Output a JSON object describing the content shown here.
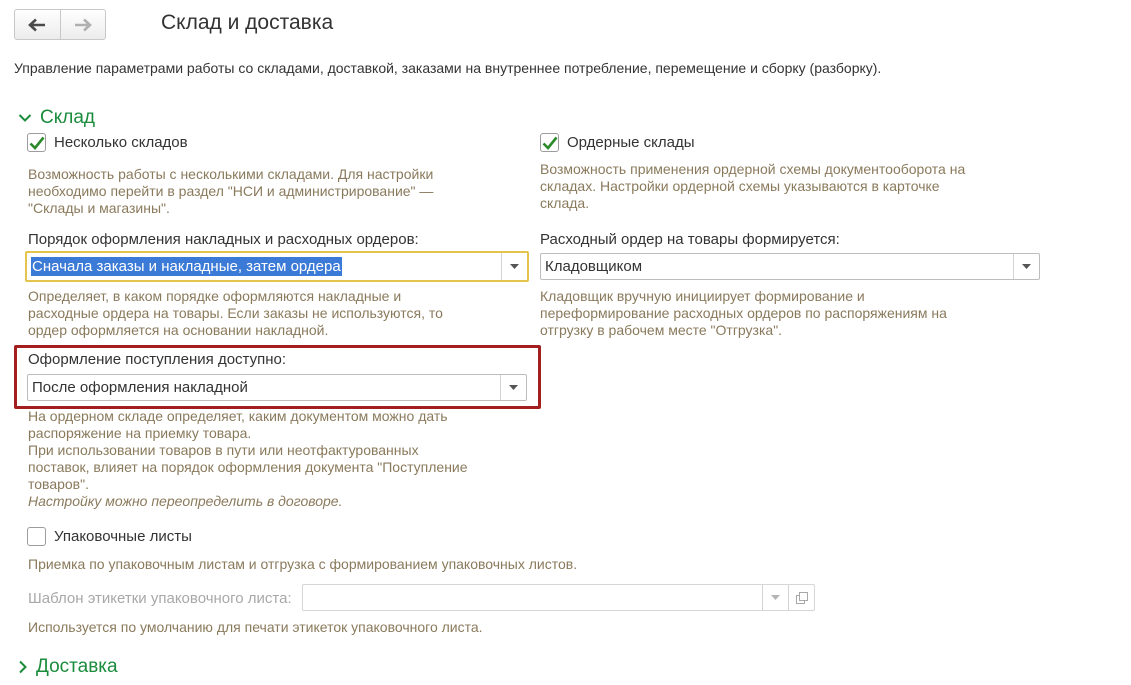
{
  "header": {
    "back_icon": "arrow-left-icon",
    "forward_icon": "arrow-right-icon",
    "title": "Склад и доставка",
    "subtitle": "Управление параметрами работы со складами, доставкой, заказами на внутреннее потребление, перемещение и сборку (разборку)."
  },
  "colors": {
    "accent_green": "#1a8c3c",
    "hint_text": "#8a7a5c",
    "highlight_red": "#a31e1e",
    "focus_yellow": "#e4c44c",
    "selection_blue": "#3b7ad6"
  },
  "sklad": {
    "title": "Склад",
    "multiple_warehouses": {
      "label": "Несколько складов",
      "checked": true,
      "hint": [
        "Возможность работы с несколькими складами. Для настройки",
        "необходимо перейти в раздел \"НСИ и администрирование\" —",
        "\"Склады и магазины\"."
      ]
    },
    "order_warehouses": {
      "label": "Ордерные склады",
      "checked": true,
      "hint": [
        "Возможность применения ордерной схемы документооборота на",
        "складах. Настройки ордерной схемы указываются в карточке",
        "склада."
      ]
    },
    "issue_order": {
      "label": "Порядок оформления накладных и расходных ордеров:",
      "value": "Сначала заказы и накладные, затем ордера",
      "hint": [
        "Определяет, в каком порядке оформляются накладные и",
        "расходные ордера на товары. Если заказы не используются, то",
        "ордер оформляется на основании накладной."
      ]
    },
    "expense_order": {
      "label": "Расходный ордер на товары формируется:",
      "value": "Кладовщиком",
      "hint": [
        "Кладовщик вручную инициирует формирование и",
        "переформирование расходных ордеров по распоряжениям на",
        "отгрузку в рабочем месте \"Отгрузка\"."
      ]
    },
    "receipt": {
      "label": "Оформление поступления доступно:",
      "value": "После оформления накладной",
      "hint": [
        "На ордерном складе определяет, каким документом можно дать",
        "распоряжение на приемку товара.",
        "При использовании товаров в пути или неотфактурованных",
        "поставок, влияет на порядок оформления документа \"Поступление",
        "товаров\"."
      ],
      "hint_italic": "Настройку можно переопределить в договоре."
    },
    "packing_lists": {
      "label": "Упаковочные листы",
      "checked": false,
      "hint": "Приемка по упаковочным листам и отгрузка с формированием упаковочных листов."
    },
    "label_template": {
      "label": "Шаблон этикетки упаковочного листа:",
      "value": "",
      "hint": "Используется по умолчанию для печати этикеток упаковочного листа."
    }
  },
  "dostavka": {
    "title": "Доставка"
  }
}
